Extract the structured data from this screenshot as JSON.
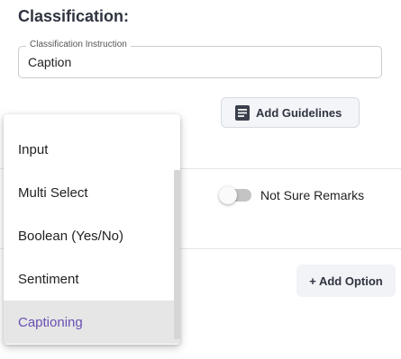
{
  "section": {
    "title": "Classification:"
  },
  "instruction_field": {
    "label": "Classification Instruction",
    "value": "Caption"
  },
  "guidelines_button": {
    "label": "Add Guidelines",
    "icon": "document-icon"
  },
  "not_sure_toggle": {
    "label": "Not Sure Remarks",
    "enabled": false
  },
  "add_option_button": {
    "label": "+ Add Option"
  },
  "dropdown": {
    "items": [
      {
        "label": "Input"
      },
      {
        "label": "Multi Select"
      },
      {
        "label": "Boolean (Yes/No)"
      },
      {
        "label": "Sentiment"
      },
      {
        "label": "Captioning"
      }
    ],
    "selected": "Captioning"
  },
  "colors": {
    "accent": "#6a4fb3",
    "heading": "#2f3440",
    "selected_bg": "#e6e6e6",
    "button_bg": "#f3f5f9"
  }
}
